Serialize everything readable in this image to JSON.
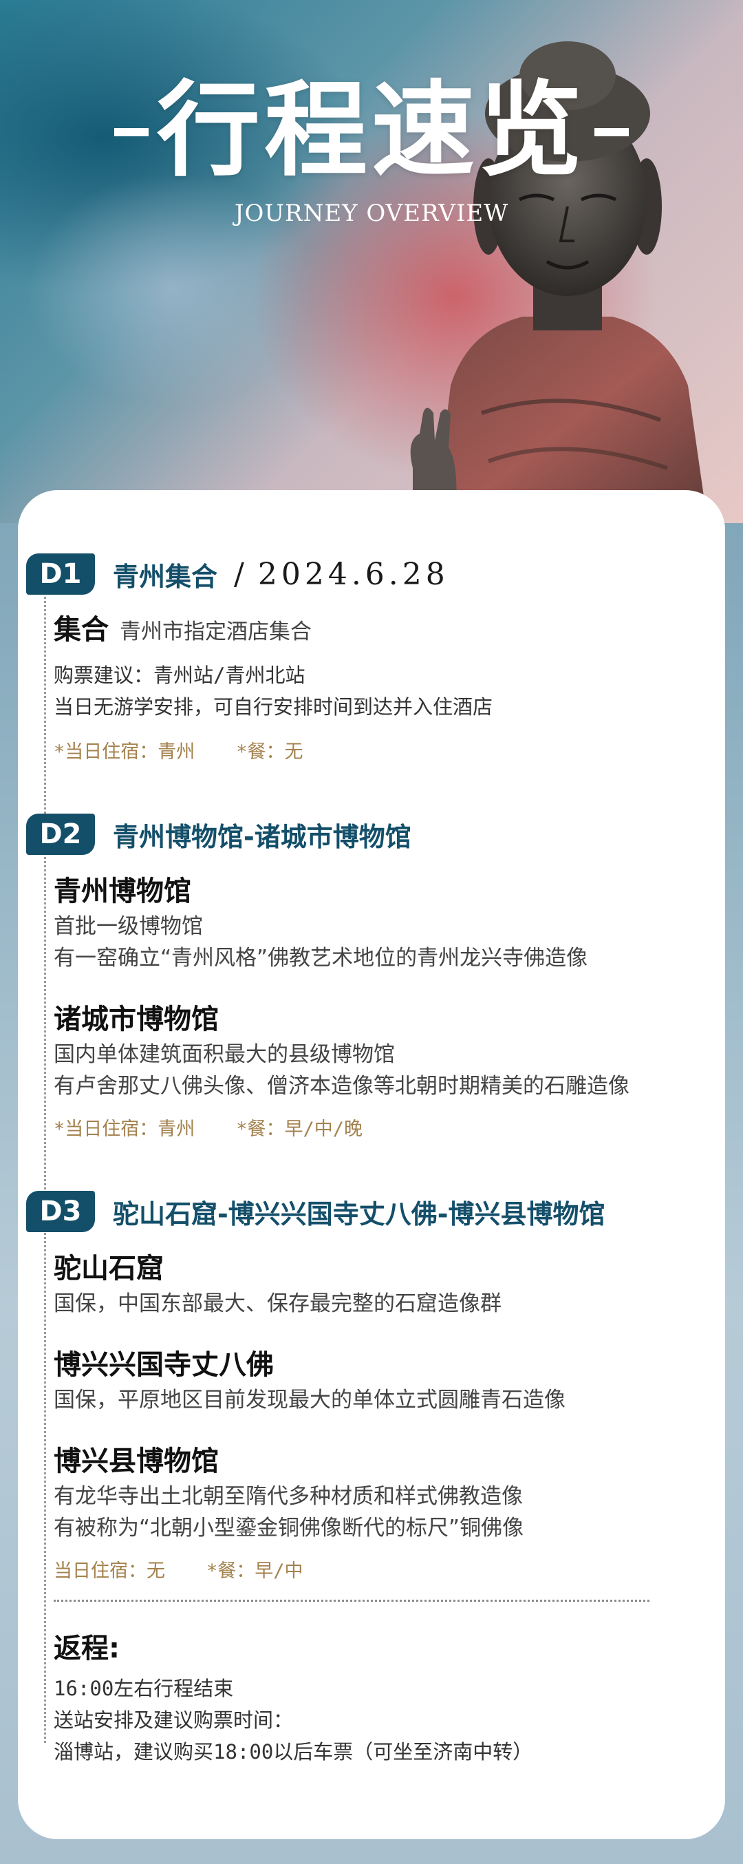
{
  "hero": {
    "title": "行程速览",
    "subtitle": "JOURNEY OVERVIEW"
  },
  "colors": {
    "accent": "#144f6a",
    "tips": "#a4824e"
  },
  "days": [
    {
      "badge": "D1",
      "title": "青州集合",
      "date": "2024.6.28",
      "meet_place": "集合",
      "meet_desc": "青州市指定酒店集合",
      "notes": [
        "购票建议：青州站/青州北站",
        "当日无游学安排，可自行安排时间到达并入住酒店"
      ],
      "stay": "*当日住宿：青州",
      "meal": "*餐：无"
    },
    {
      "badge": "D2",
      "title": "青州博物馆-诸城市博物馆",
      "places": [
        {
          "name": "青州博物馆",
          "lines": [
            "首批一级博物馆",
            "有一窑确立“青州风格”佛教艺术地位的青州龙兴寺佛造像"
          ]
        },
        {
          "name": "诸城市博物馆",
          "lines": [
            "国内单体建筑面积最大的县级博物馆",
            "有卢舍那丈八佛头像、僧济本造像等北朝时期精美的石雕造像"
          ]
        }
      ],
      "stay": "*当日住宿：青州",
      "meal": "*餐：早/中/晚"
    },
    {
      "badge": "D3",
      "title": "驼山石窟-博兴兴国寺丈八佛-博兴县博物馆",
      "places": [
        {
          "name": "驼山石窟",
          "lines": [
            "国保，中国东部最大、保存最完整的石窟造像群"
          ]
        },
        {
          "name": "博兴兴国寺丈八佛",
          "lines": [
            "国保，平原地区目前发现最大的单体立式圆雕青石造像"
          ]
        },
        {
          "name": "博兴县博物馆",
          "lines": [
            "有龙华寺出土北朝至隋代多种材质和样式佛教造像",
            "有被称为“北朝小型鎏金铜佛像断代的标尺”铜佛像"
          ]
        }
      ],
      "stay": "当日住宿：无",
      "meal": "*餐：早/中"
    }
  ],
  "return": {
    "title": "返程:",
    "lines": [
      "16:00左右行程结束",
      "送站安排及建议购票时间：",
      "淄博站，建议购买18:00以后车票（可坐至济南中转）"
    ]
  }
}
